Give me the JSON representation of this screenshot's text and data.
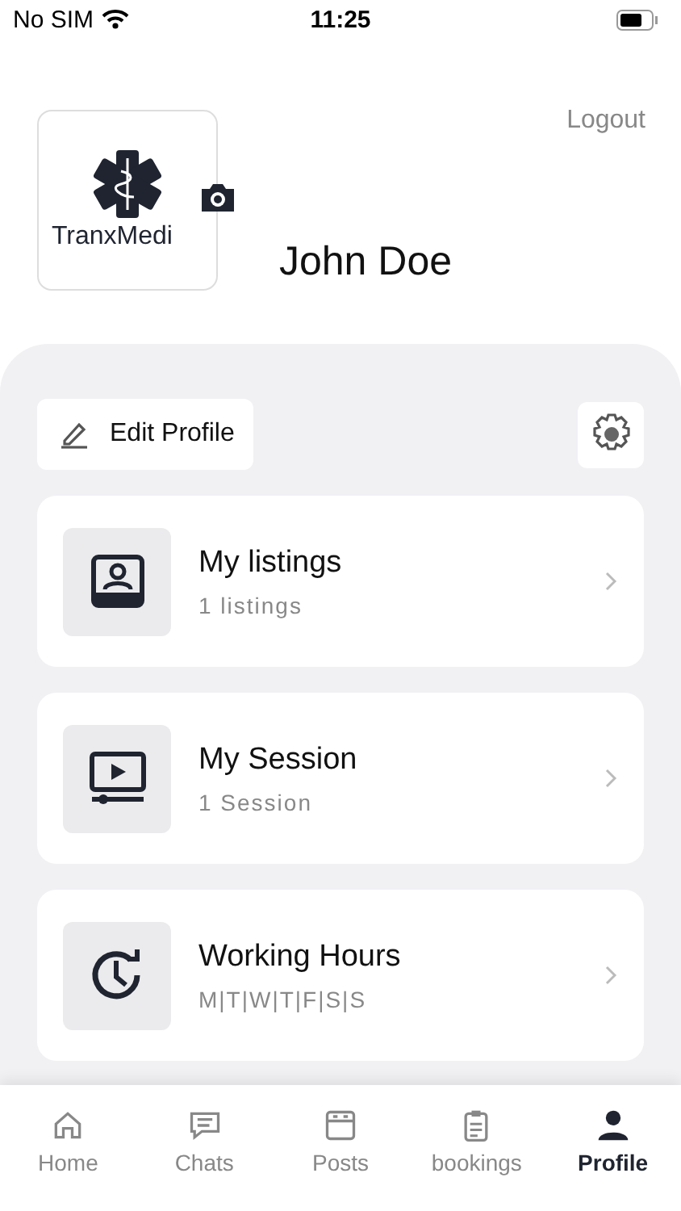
{
  "status_bar": {
    "carrier": "No SIM",
    "time": "11:25"
  },
  "profile": {
    "logo_text": "TranxMedi",
    "name": "John Doe",
    "logout": "Logout"
  },
  "actions": {
    "edit_profile": "Edit Profile"
  },
  "menu": [
    {
      "kind": "listings",
      "title": "My listings",
      "subtitle": "1 listings"
    },
    {
      "kind": "session",
      "title": "My Session",
      "subtitle": "1 Session"
    },
    {
      "kind": "hours",
      "title": "Working Hours",
      "subtitle": "M|T|W|T|F|S|S"
    }
  ],
  "tabs": [
    {
      "kind": "home",
      "label": "Home",
      "selected": false
    },
    {
      "kind": "chats",
      "label": "Chats",
      "selected": false
    },
    {
      "kind": "posts",
      "label": "Posts",
      "selected": false
    },
    {
      "kind": "bookings",
      "label": "bookings",
      "selected": false
    },
    {
      "kind": "profile",
      "label": "Profile",
      "selected": true
    }
  ]
}
